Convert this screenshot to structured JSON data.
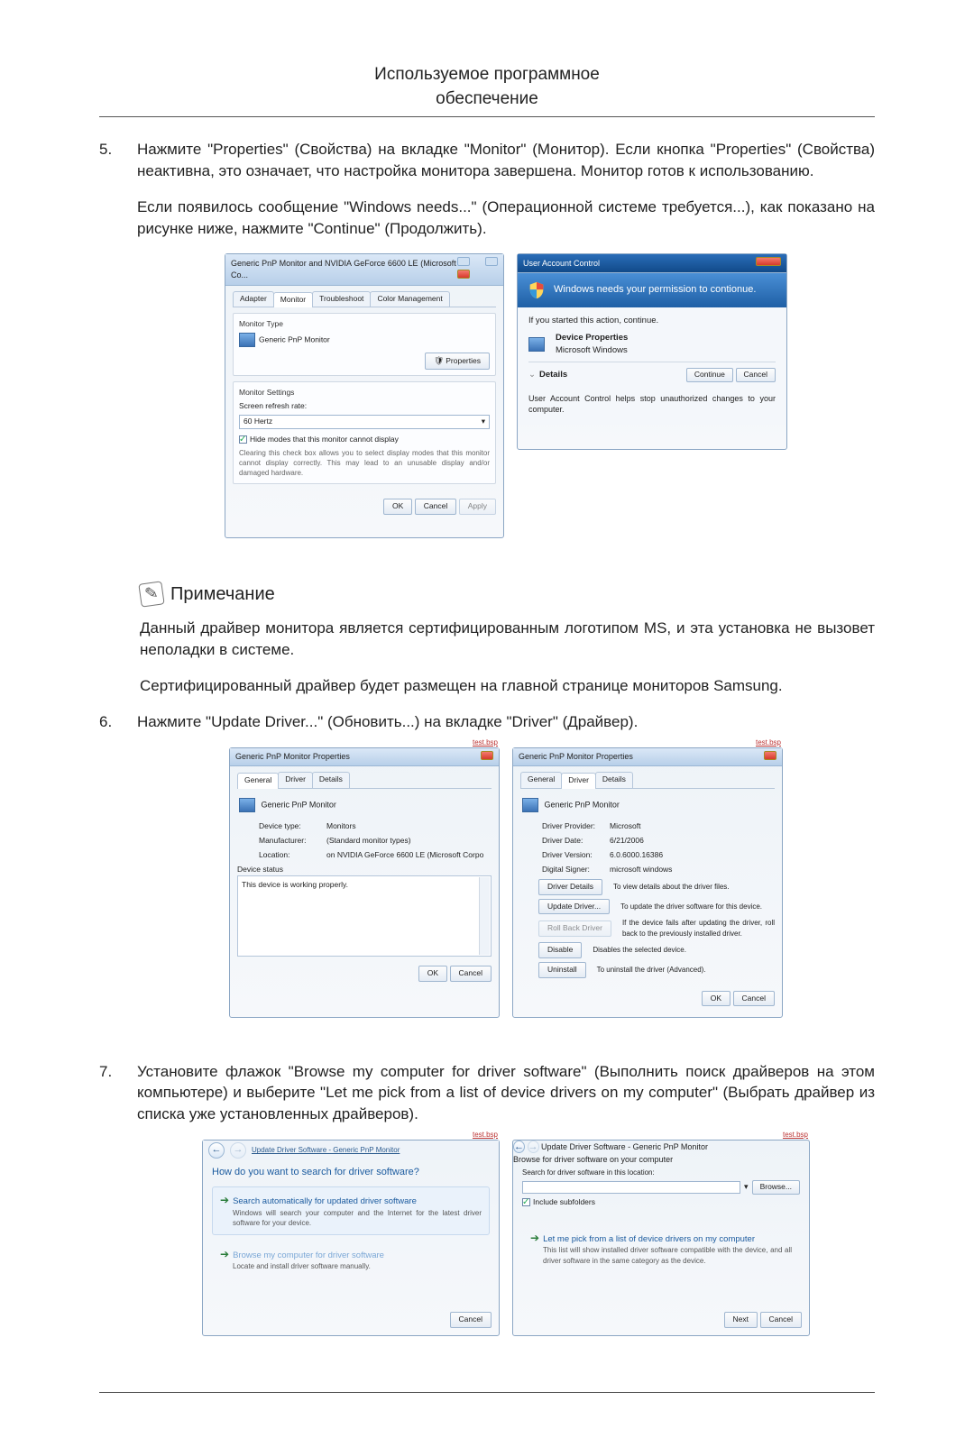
{
  "doc": {
    "title_line1": "Используемое программное",
    "title_line2": "обеспечение"
  },
  "step5": {
    "num": "5.",
    "p1": "Нажмите \"Properties\" (Свойства) на вкладке \"Monitor\" (Монитор). Если кнопка \"Properties\" (Свойства) неактивна, это означает, что настройка монитора завершена. Монитор готов к использованию.",
    "p2": "Если появилось сообщение \"Windows needs...\" (Операционной системе требуется...), как показано на рисунке ниже, нажмите \"Continue\" (Продолжить)."
  },
  "monprops": {
    "title": "Generic PnP Monitor and NVIDIA GeForce 6600 LE (Microsoft Co...",
    "tabs": {
      "adapter": "Adapter",
      "monitor": "Monitor",
      "troubleshoot": "Troubleshoot",
      "color": "Color Management"
    },
    "group_monitor_type": "Monitor Type",
    "monitor_name": "Generic PnP Monitor",
    "btn_properties": "Properties",
    "group_settings": "Monitor Settings",
    "refresh_label": "Screen refresh rate:",
    "refresh_value": "60 Hertz",
    "hide_modes": "Hide modes that this monitor cannot display",
    "hide_modes_note": "Clearing this check box allows you to select display modes that this monitor cannot display correctly. This may lead to an unusable display and/or damaged hardware.",
    "ok": "OK",
    "cancel": "Cancel",
    "apply": "Apply"
  },
  "uac": {
    "title": "User Account Control",
    "headline": "Windows needs your permission to contionue.",
    "if_started": "If you started this action, continue.",
    "prog_name": "Device Properties",
    "prog_vendor": "Microsoft Windows",
    "details": "Details",
    "continue": "Continue",
    "cancel": "Cancel",
    "footer": "User Account Control helps stop unauthorized changes to your computer."
  },
  "note": {
    "label": "Примечание",
    "p1": "Данный драйвер монитора является сертифицированным логотипом MS, и эта установка не вызовет неполадки в системе.",
    "p2": "Сертифицированный драйвер будет размещен на главной странице мониторов Samsung."
  },
  "step6": {
    "num": "6.",
    "p1": "Нажмите \"Update Driver...\" (Обновить...) на вкладке \"Driver\" (Драйвер)."
  },
  "pnp_general": {
    "title": "Generic PnP Monitor Properties",
    "tabs": {
      "general": "General",
      "driver": "Driver",
      "details": "Details"
    },
    "name": "Generic PnP Monitor",
    "device_type_l": "Device type:",
    "device_type_v": "Monitors",
    "manufacturer_l": "Manufacturer:",
    "manufacturer_v": "(Standard monitor types)",
    "location_l": "Location:",
    "location_v": "on NVIDIA GeForce 6600 LE (Microsoft Corpo",
    "status_label": "Device status",
    "status_text": "This device is working properly.",
    "ok": "OK",
    "cancel": "Cancel"
  },
  "pnp_driver": {
    "title": "Generic PnP Monitor Properties",
    "tabs": {
      "general": "General",
      "driver": "Driver",
      "details": "Details"
    },
    "name": "Generic PnP Monitor",
    "provider_l": "Driver Provider:",
    "provider_v": "Microsoft",
    "date_l": "Driver Date:",
    "date_v": "6/21/2006",
    "version_l": "Driver Version:",
    "version_v": "6.0.6000.16386",
    "signer_l": "Digital Signer:",
    "signer_v": "microsoft windows",
    "btn_details": "Driver Details",
    "desc_details": "To view details about the driver files.",
    "btn_update": "Update Driver...",
    "desc_update": "To update the driver software for this device.",
    "btn_rollback": "Roll Back Driver",
    "desc_rollback": "If the device fails after updating the driver, roll back to the previously installed driver.",
    "btn_disable": "Disable",
    "desc_disable": "Disables the selected device.",
    "btn_uninstall": "Uninstall",
    "desc_uninstall": "To uninstall the driver (Advanced).",
    "ok": "OK",
    "cancel": "Cancel"
  },
  "step7": {
    "num": "7.",
    "p1": "Установите флажок \"Browse my computer for driver software\" (Выполнить поиск драйверов на этом компьютере) и выберите \"Let me pick from a list of device drivers on my computer\" (Выбрать драйвер из списка уже установленных драйверов)."
  },
  "wiz1": {
    "path": "Update Driver Software - Generic PnP Monitor",
    "red": "test.bsp",
    "heading": "How do you want to search for driver software?",
    "opt1_title": "Search automatically for updated driver software",
    "opt1_desc": "Windows will search your computer and the Internet for the latest driver software for your device.",
    "opt2_title": "Browse my computer for driver software",
    "opt2_desc": "Locate and install driver software manually.",
    "cancel": "Cancel"
  },
  "wiz2": {
    "path": "Update Driver Software - Generic PnP Monitor",
    "red": "test.bsp",
    "heading": "Browse for driver software on your computer",
    "search_label": "Search for driver software in this location:",
    "browse": "Browse...",
    "include": "Include subfolders",
    "opt_title": "Let me pick from a list of device drivers on my computer",
    "opt_desc": "This list will show installed driver software compatible with the device, and all driver software in the same category as the device.",
    "next": "Next",
    "cancel": "Cancel"
  }
}
